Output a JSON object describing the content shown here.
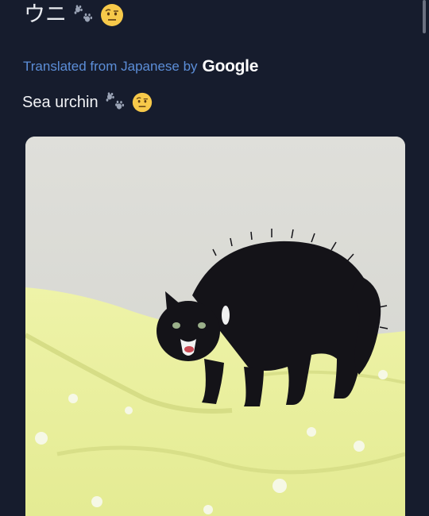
{
  "post": {
    "text": "ウニ",
    "emojis": [
      "paw-prints-icon",
      "face-with-raised-eyebrow-icon"
    ]
  },
  "translation": {
    "label": "Translated from Japanese by",
    "provider": "Google",
    "text": "Sea urchin",
    "emojis": [
      "paw-prints-icon",
      "face-with-raised-eyebrow-icon"
    ]
  },
  "media": {
    "subject": "photo"
  },
  "colors": {
    "background": "#161c2d",
    "translate_link": "#5c8ed8",
    "text": "#e9ebf0"
  }
}
